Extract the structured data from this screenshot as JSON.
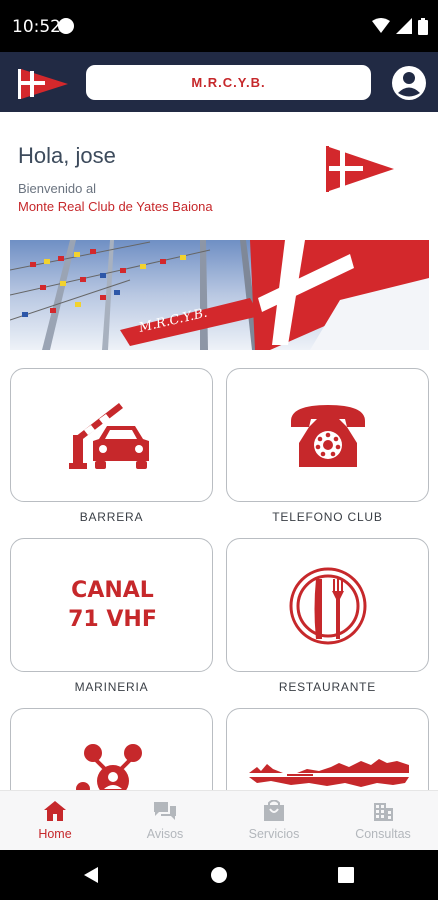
{
  "status_bar": {
    "time": "10:52",
    "icons": [
      "wifi-icon",
      "signal-icon",
      "battery-icon"
    ]
  },
  "app_bar": {
    "title": "M.R.C.Y.B.",
    "logo": "club-flag-icon",
    "account_icon": "account-circle-icon"
  },
  "greeting": {
    "hello": "Hola, jose",
    "welcome_line": "Bienvenido al",
    "club_name": "Monte Real Club de Yates Baiona"
  },
  "tiles": [
    {
      "label": "BARRERA",
      "icon": "barrier-car-icon"
    },
    {
      "label": "TELEFONO CLUB",
      "icon": "telephone-icon"
    },
    {
      "label": "MARINERIA",
      "icon": "radio-channel-text",
      "text_line1": "CANAL",
      "text_line2": "71 VHF"
    },
    {
      "label": "RESTAURANTE",
      "icon": "restaurant-icon"
    },
    {
      "label": "",
      "icon": "group-people-icon"
    },
    {
      "label": "",
      "icon": "landscape-reflection-icon"
    }
  ],
  "bottom_nav": [
    {
      "label": "Home",
      "icon": "home-icon",
      "active": true
    },
    {
      "label": "Avisos",
      "icon": "chat-icon",
      "active": false
    },
    {
      "label": "Servicios",
      "icon": "shopping-bag-icon",
      "active": false
    },
    {
      "label": "Consultas",
      "icon": "building-icon",
      "active": false
    }
  ],
  "colors": {
    "accent": "#c6282b",
    "app_bar": "#212a44",
    "tile_border": "#b9bdc2",
    "nav_inactive": "#b3b7bc"
  }
}
